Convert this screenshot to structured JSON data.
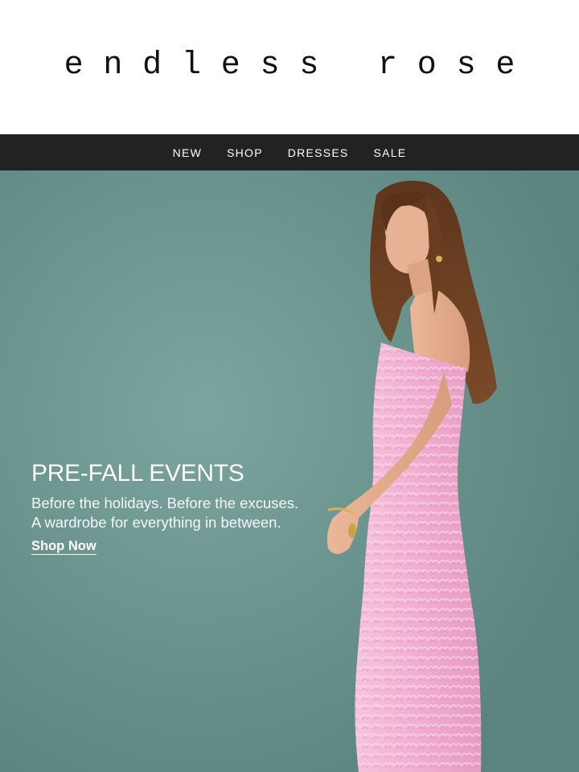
{
  "brand": {
    "logo_text": "endless rose"
  },
  "nav": {
    "items": [
      {
        "label": "NEW"
      },
      {
        "label": "SHOP"
      },
      {
        "label": "DRESSES"
      },
      {
        "label": "SALE"
      }
    ]
  },
  "hero": {
    "title": "PRE-FALL EVENTS",
    "subtitle_line1": "Before the holidays. Before the excuses.",
    "subtitle_line2": "A wardrobe for everything in between.",
    "cta_label": "Shop Now",
    "colors": {
      "background": "#6d9790",
      "dress": "#f2b3d3",
      "hair": "#6b3f22",
      "skin": "#e2ad8e"
    }
  }
}
